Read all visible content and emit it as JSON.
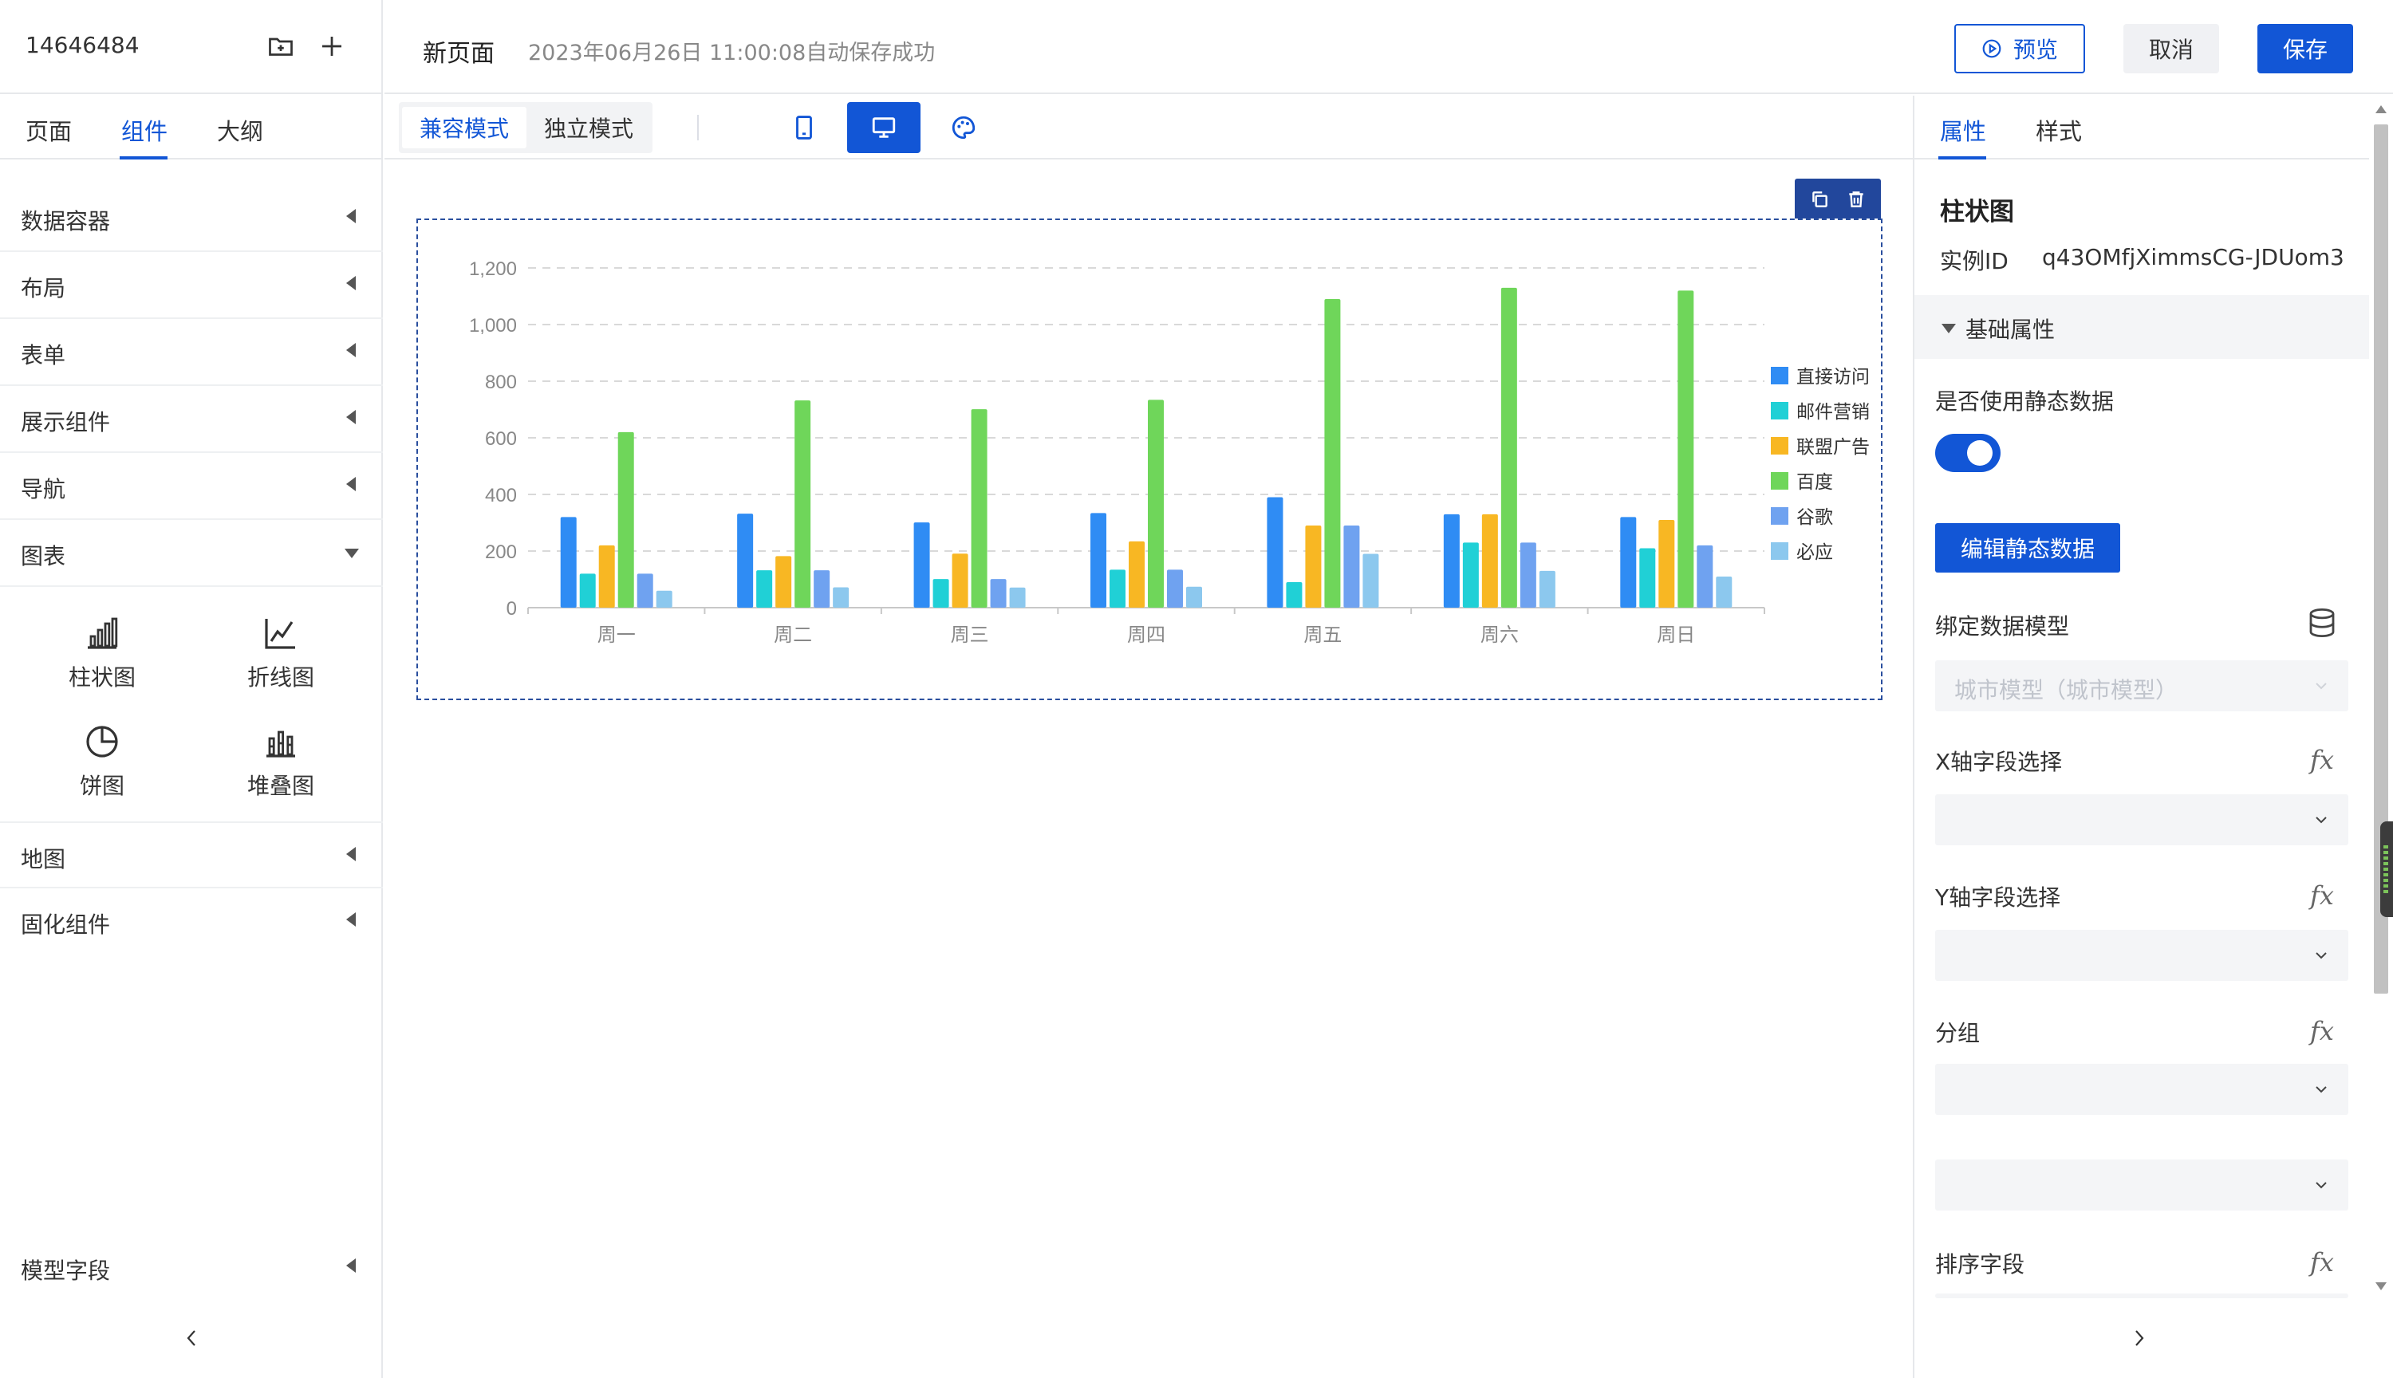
{
  "left": {
    "app_id": "14646484",
    "tabs": [
      {
        "label": "页面"
      },
      {
        "label": "组件"
      },
      {
        "label": "大纲"
      }
    ],
    "categories": [
      {
        "label": "数据容器"
      },
      {
        "label": "布局"
      },
      {
        "label": "表单"
      },
      {
        "label": "展示组件"
      },
      {
        "label": "导航"
      },
      {
        "label": "图表"
      },
      {
        "label": "地图"
      },
      {
        "label": "固化组件"
      },
      {
        "label": "模型字段"
      }
    ],
    "chart_components": [
      {
        "label": "柱状图",
        "icon": "bar-chart-icon"
      },
      {
        "label": "折线图",
        "icon": "line-chart-icon"
      },
      {
        "label": "饼图",
        "icon": "pie-chart-icon"
      },
      {
        "label": "堆叠图",
        "icon": "stacked-chart-icon"
      }
    ]
  },
  "header": {
    "page_name": "新页面",
    "save_status": "2023年06月26日 11:00:08自动保存成功",
    "preview_label": "预览",
    "cancel_label": "取消",
    "save_label": "保存"
  },
  "toolbar": {
    "modes": [
      {
        "label": "兼容模式"
      },
      {
        "label": "独立模式"
      }
    ]
  },
  "right": {
    "tabs": [
      {
        "label": "属性"
      },
      {
        "label": "样式"
      }
    ],
    "component_title": "柱状图",
    "instance_label": "实例ID",
    "instance_id": "q43OMfjXimmsCG-JDUom3",
    "section_basic": "基础属性",
    "static_data_label": "是否使用静态数据",
    "static_data_on": true,
    "edit_static_label": "编辑静态数据",
    "model_label": "绑定数据模型",
    "model_placeholder": "城市模型（城市模型）",
    "x_field_label": "X轴字段选择",
    "y_field_label": "Y轴字段选择",
    "group_label": "分组",
    "sort_label": "排序字段",
    "fx": "fx"
  },
  "colors": {
    "accent": "#1256d6",
    "series": [
      "#2f8cf4",
      "#20d0d6",
      "#f8b723",
      "#6fd65a",
      "#6fa2f0",
      "#8cc8ee"
    ]
  },
  "chart_data": {
    "type": "bar",
    "categories": [
      "周一",
      "周二",
      "周三",
      "周四",
      "周五",
      "周六",
      "周日"
    ],
    "ylim": [
      0,
      1200
    ],
    "yticks": [
      0,
      200,
      400,
      600,
      800,
      1000,
      1200
    ],
    "ytick_labels": [
      "0",
      "200",
      "400",
      "600",
      "800",
      "1,000",
      "1,200"
    ],
    "grid": true,
    "legend": "right",
    "series": [
      {
        "name": "直接访问",
        "values": [
          320,
          332,
          301,
          334,
          390,
          330,
          320
        ]
      },
      {
        "name": "邮件营销",
        "values": [
          120,
          132,
          101,
          134,
          90,
          230,
          210
        ]
      },
      {
        "name": "联盟广告",
        "values": [
          220,
          182,
          191,
          234,
          290,
          330,
          310
        ]
      },
      {
        "name": "百度",
        "values": [
          620,
          732,
          701,
          734,
          1090,
          1130,
          1120
        ]
      },
      {
        "name": "谷歌",
        "values": [
          120,
          132,
          101,
          134,
          290,
          230,
          220
        ]
      },
      {
        "name": "必应",
        "values": [
          60,
          72,
          71,
          74,
          190,
          130,
          110
        ]
      }
    ]
  }
}
